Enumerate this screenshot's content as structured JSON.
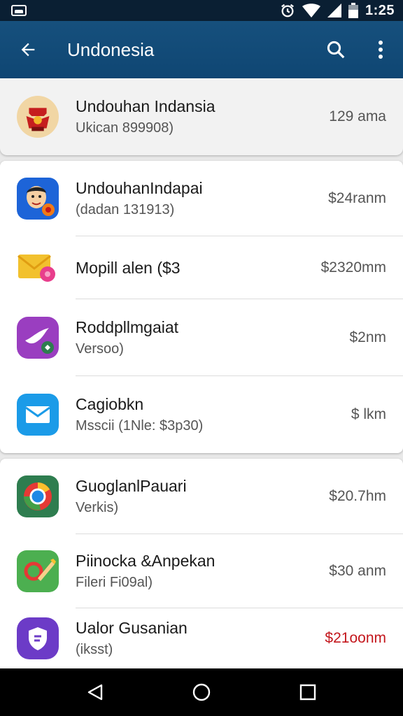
{
  "status_bar": {
    "time": "1:25",
    "icons": [
      "notification-icon",
      "alarm-icon",
      "wifi-icon",
      "signal-icon",
      "battery-icon"
    ]
  },
  "app_bar": {
    "title": "Undonesia",
    "icons": [
      "back-arrow-icon",
      "search-icon",
      "overflow-menu-icon"
    ]
  },
  "header_item": {
    "title": "Undouhan Indansia",
    "subtitle": "Ukican 899908)",
    "price": "129 ama",
    "icon": "garuda-emblem-icon"
  },
  "list_group_1": [
    {
      "title": "UndouhanIndapai",
      "subtitle": "(dadan 131913)",
      "price": "$24ranm",
      "icon": "cartoon-face-icon"
    },
    {
      "title": "Mopill alen ($3",
      "subtitle": "",
      "price": "$2320mm",
      "icon": "envelope-flower-icon"
    },
    {
      "title": "Roddpllmgaiat",
      "subtitle": "Versoo)",
      "price": "$2nm",
      "icon": "purple-bird-icon"
    },
    {
      "title": "Cagiobkn",
      "subtitle": "Msscii (1Nle: $3p30)",
      "price": "$ lkm",
      "icon": "blue-mail-icon"
    }
  ],
  "list_group_2": [
    {
      "title": "GuoglanlPauari",
      "subtitle": "Verkis)",
      "price": "$20.7hm",
      "icon": "browser-globe-icon",
      "price_color": "#555555"
    },
    {
      "title": "Piinocka &Anpekan",
      "subtitle": "Fileri Fi09al)",
      "price": "$30 anm",
      "icon": "search-pen-icon",
      "price_color": "#555555"
    },
    {
      "title": "Ualor Gusanian",
      "subtitle": "(iksst)",
      "price": "$21oonm",
      "icon": "purple-shield-icon",
      "price_color": "#c3161c"
    }
  ],
  "nav_bar": {
    "icons": [
      "back-triangle-icon",
      "home-circle-icon",
      "recents-square-icon"
    ]
  }
}
